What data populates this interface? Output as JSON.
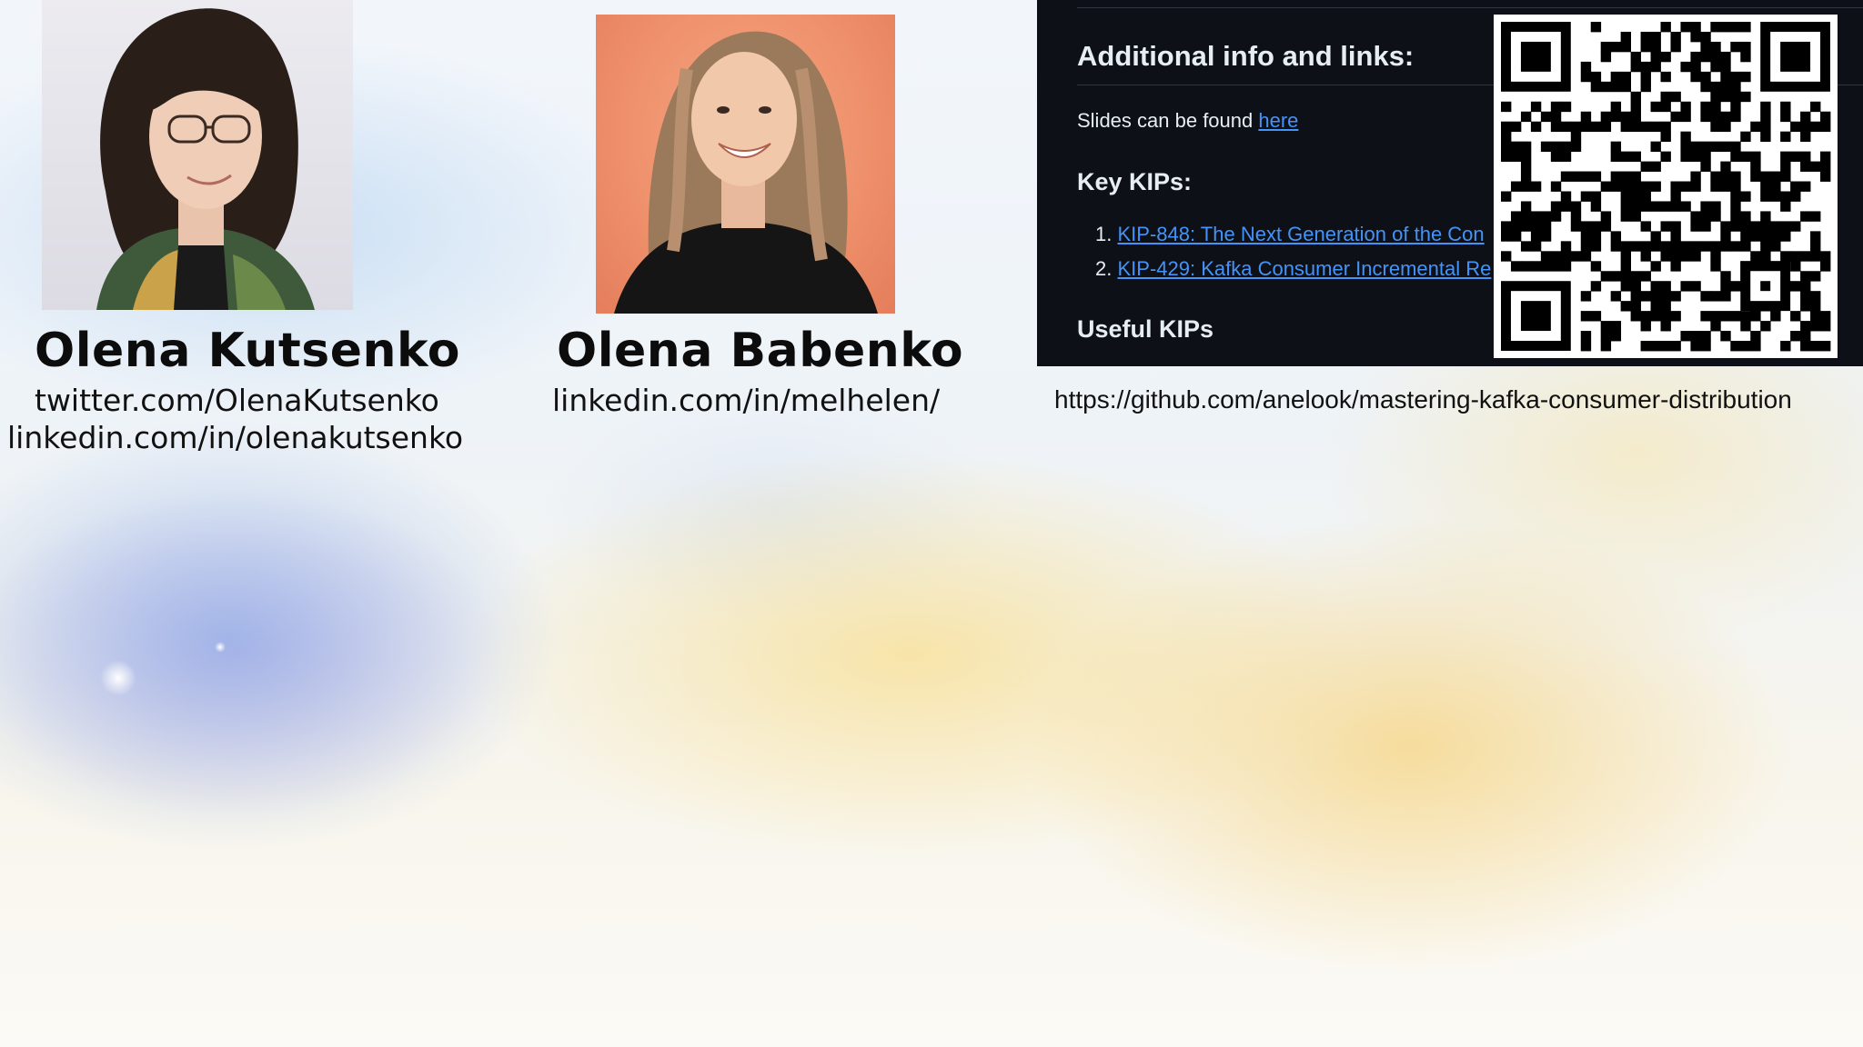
{
  "speakers": [
    {
      "name": "Olena Kutsenko",
      "links": [
        "twitter.com/OlenaKutsenko",
        "linkedin.com/in/olenakutsenko"
      ]
    },
    {
      "name": "Olena Babenko",
      "links": [
        "linkedin.com/in/melhelen/"
      ]
    }
  ],
  "panel": {
    "heading": "Additional info and links:",
    "slides_text": "Slides can be found ",
    "slides_link": "here",
    "key_kips_heading": "Key KIPs:",
    "kips": [
      {
        "number": "1.",
        "label": "KIP-848: The Next Generation of the Con"
      },
      {
        "number": "2.",
        "label": "KIP-429: Kafka Consumer Incremental Re"
      }
    ],
    "useful_kips_heading": "Useful KIPs"
  },
  "repo_url": "https://github.com/anelook/mastering-kafka-consumer-distribution",
  "qr_icon": "qr-code-icon",
  "colors": {
    "panel_bg": "#0d1117",
    "panel_text": "#e6edf3",
    "link": "#4493f8"
  }
}
